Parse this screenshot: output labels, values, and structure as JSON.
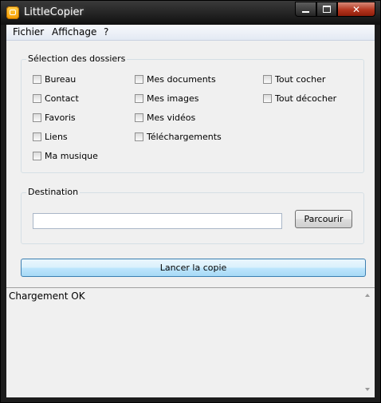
{
  "window": {
    "title": "LittleCopier"
  },
  "menu": [
    "Fichier",
    "Affichage",
    "?"
  ],
  "folders_group": {
    "title": "Sélection des dossiers",
    "col1": [
      "Bureau",
      "Contact",
      "Favoris",
      "Liens",
      "Ma musique"
    ],
    "col2": [
      "Mes documents",
      "Mes images",
      "Mes vidéos",
      "Téléchargements"
    ],
    "col3": [
      "Tout cocher",
      "Tout décocher"
    ]
  },
  "destination_group": {
    "title": "Destination",
    "path_value": "",
    "browse_label": "Parcourir"
  },
  "launch_label": "Lancer la copie",
  "log": {
    "text": "Chargement OK"
  }
}
